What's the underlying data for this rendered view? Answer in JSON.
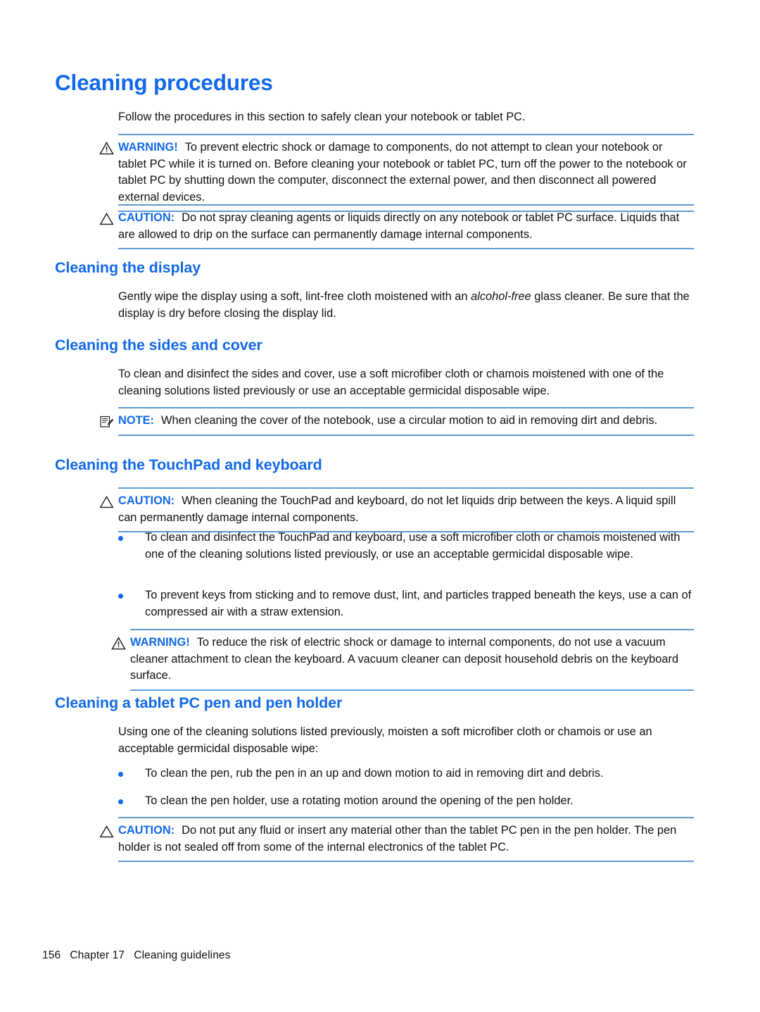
{
  "page": {
    "title": "Cleaning procedures",
    "intro": "Follow the procedures in this section to safely clean your notebook or tablet PC.",
    "accent_color": "#1169e8",
    "rule_color": "#5b9bd5",
    "text_color": "#111111"
  },
  "admonitions": {
    "warning_clean": {
      "icon": "warning-triangle-icon",
      "label": "WARNING!",
      "text": "To prevent electric shock or damage to components, do not attempt to clean your notebook or tablet PC while it is turned on. Before cleaning your notebook or tablet PC, turn off the power to the notebook or tablet PC by shutting down the computer, disconnect the external power, and then disconnect all powered external devices."
    },
    "caution_spray": {
      "icon": "caution-triangle-icon",
      "label": "CAUTION:",
      "text": "Do not spray cleaning agents or liquids directly on any notebook or tablet PC surface. Liquids that are allowed to drip on the surface can permanently damage internal components."
    },
    "note_cover": {
      "icon": "note-pad-icon",
      "label": "NOTE:",
      "text": "When cleaning the cover of the notebook, use a circular motion to aid in removing dirt and debris."
    },
    "caution_touchpad": {
      "icon": "caution-triangle-icon",
      "label": "CAUTION:",
      "text": "When cleaning the TouchPad and keyboard, do not let liquids drip between the keys. A liquid spill can permanently damage internal components."
    },
    "warning_vacuum": {
      "icon": "warning-triangle-icon",
      "label": "WARNING!",
      "text": "To reduce the risk of electric shock or damage to internal components, do not use a vacuum cleaner attachment to clean the keyboard. A vacuum cleaner can deposit household debris on the keyboard surface."
    },
    "caution_penholder": {
      "icon": "caution-triangle-icon",
      "label": "CAUTION:",
      "text": "Do not put any fluid or insert any material other than the tablet PC pen in the pen holder. The pen holder is not sealed off from some of the internal electronics of the tablet PC."
    }
  },
  "sections": {
    "display": {
      "heading": "Cleaning the display",
      "para": "Gently wipe the display using a soft, lint-free cloth moistened with an ",
      "para_italic": "alcohol-free",
      "para_tail": " glass cleaner. Be sure that the display is dry before closing the display lid."
    },
    "sides": {
      "heading": "Cleaning the sides and cover",
      "para": "To clean and disinfect the sides and cover, use a soft microfiber cloth or chamois moistened with one of the cleaning solutions listed previously or use an acceptable germicidal disposable wipe."
    },
    "touchpad": {
      "heading": "Cleaning the TouchPad and keyboard",
      "bullets": [
        "To clean and disinfect the TouchPad and keyboard, use a soft microfiber cloth or chamois moistened with one of the cleaning solutions listed previously, or use an acceptable germicidal disposable wipe.",
        "To prevent keys from sticking and to remove dust, lint, and particles trapped beneath the keys, use a can of compressed air with a straw extension."
      ]
    },
    "pen": {
      "heading": "Cleaning a tablet PC pen and pen holder",
      "para": "Using one of the cleaning solutions listed previously, moisten a soft microfiber cloth or chamois or use an acceptable germicidal disposable wipe:",
      "bullets": [
        "To clean the pen, rub the pen in an up and down motion to aid in removing dirt and debris.",
        "To clean the pen holder, use a rotating motion around the opening of the pen holder."
      ]
    }
  },
  "footer": {
    "page_number": "156",
    "chapter": "Chapter 17",
    "chapter_title": "Cleaning guidelines",
    "combined": "156   Chapter 17   Cleaning guidelines"
  }
}
